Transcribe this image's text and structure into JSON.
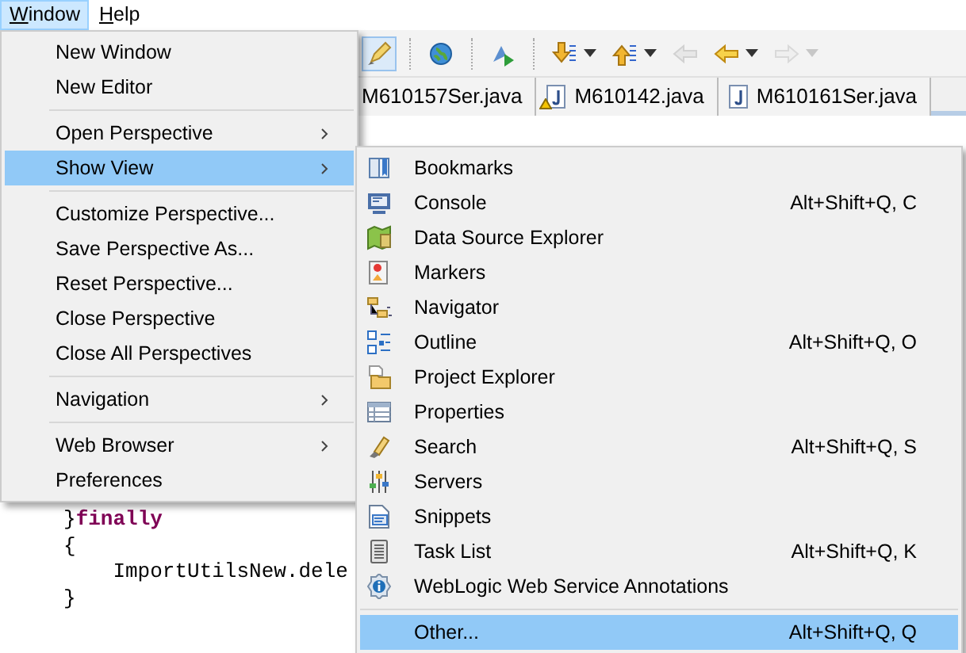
{
  "menubar": [
    {
      "label": "Window",
      "selected": true
    },
    {
      "label": "Help",
      "selected": false
    }
  ],
  "toolbar_buttons": [
    {
      "pressed": true,
      "disabled": false,
      "dropdown": false
    },
    {
      "pressed": false,
      "disabled": false,
      "dropdown": false
    },
    {
      "pressed": false,
      "disabled": false,
      "dropdown": false
    },
    {
      "pressed": false,
      "disabled": false,
      "dropdown": true
    },
    {
      "pressed": false,
      "disabled": false,
      "dropdown": true
    },
    {
      "pressed": false,
      "disabled": true,
      "dropdown": false
    },
    {
      "pressed": false,
      "disabled": false,
      "dropdown": true
    },
    {
      "pressed": false,
      "disabled": true,
      "dropdown": true
    }
  ],
  "editor_tabs": [
    {
      "label": "M610157Ser.java",
      "warning": false
    },
    {
      "label": "M610142.java",
      "warning": true
    },
    {
      "label": "M610161Ser.java",
      "warning": false
    }
  ],
  "code_lines": [
    {
      "text": "}**finally**"
    },
    {
      "text": "{"
    },
    {
      "text": "    ImportUtilsNew.dele"
    },
    {
      "text": "}"
    }
  ],
  "window_menu": [
    {
      "kind": "item",
      "label": "New Window",
      "submenu": false,
      "selected": false
    },
    {
      "kind": "item",
      "label": "New Editor",
      "submenu": false,
      "selected": false
    },
    {
      "kind": "separator"
    },
    {
      "kind": "item",
      "label": "Open Perspective",
      "submenu": true,
      "selected": false
    },
    {
      "kind": "item",
      "label": "Show View",
      "submenu": true,
      "selected": true
    },
    {
      "kind": "separator"
    },
    {
      "kind": "item",
      "label": "Customize Perspective...",
      "submenu": false,
      "selected": false
    },
    {
      "kind": "item",
      "label": "Save Perspective As...",
      "submenu": false,
      "selected": false
    },
    {
      "kind": "item",
      "label": "Reset Perspective...",
      "submenu": false,
      "selected": false
    },
    {
      "kind": "item",
      "label": "Close Perspective",
      "submenu": false,
      "selected": false
    },
    {
      "kind": "item",
      "label": "Close All Perspectives",
      "submenu": false,
      "selected": false
    },
    {
      "kind": "separator"
    },
    {
      "kind": "item",
      "label": "Navigation",
      "submenu": true,
      "selected": false
    },
    {
      "kind": "separator"
    },
    {
      "kind": "item",
      "label": "Web Browser",
      "submenu": true,
      "selected": false
    },
    {
      "kind": "item",
      "label": "Preferences",
      "submenu": false,
      "selected": false
    }
  ],
  "show_view_menu": [
    {
      "kind": "item",
      "label": "Bookmarks",
      "selected": false
    },
    {
      "kind": "item",
      "label": "Console",
      "shortcut": "Alt+Shift+Q, C",
      "selected": false
    },
    {
      "kind": "item",
      "label": "Data Source Explorer",
      "selected": false
    },
    {
      "kind": "item",
      "label": "Markers",
      "selected": false
    },
    {
      "kind": "item",
      "label": "Navigator",
      "selected": false
    },
    {
      "kind": "item",
      "label": "Outline",
      "shortcut": "Alt+Shift+Q, O",
      "selected": false
    },
    {
      "kind": "item",
      "label": "Project Explorer",
      "selected": false
    },
    {
      "kind": "item",
      "label": "Properties",
      "selected": false
    },
    {
      "kind": "item",
      "label": "Search",
      "shortcut": "Alt+Shift+Q, S",
      "selected": false
    },
    {
      "kind": "item",
      "label": "Servers",
      "selected": false
    },
    {
      "kind": "item",
      "label": "Snippets",
      "selected": false
    },
    {
      "kind": "item",
      "label": "Task List",
      "shortcut": "Alt+Shift+Q, K",
      "selected": false
    },
    {
      "kind": "item",
      "label": "WebLogic Web Service Annotations",
      "selected": false
    },
    {
      "kind": "separator"
    },
    {
      "kind": "item",
      "label": "Other...",
      "shortcut": "Alt+Shift+Q, Q",
      "selected": true
    }
  ]
}
